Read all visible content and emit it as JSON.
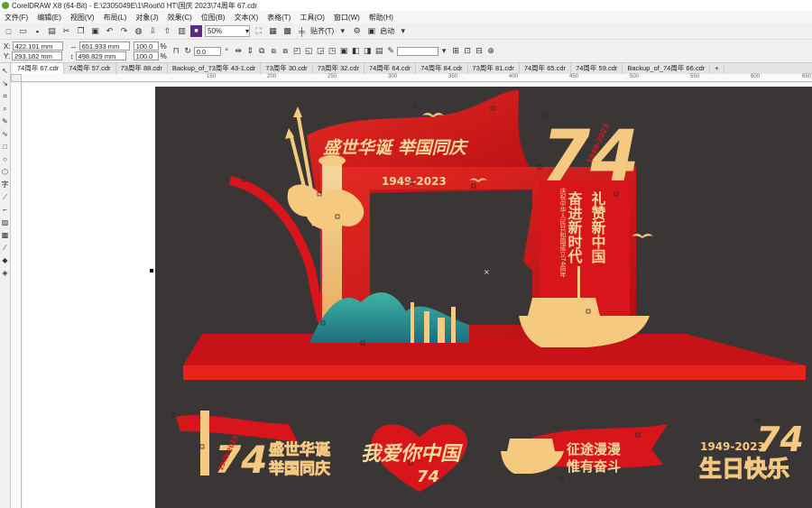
{
  "window": {
    "title": "CorelDRAW X8 (64-Bit) - E:\\2305049E\\1\\Root\\0 HT\\国庆 2023\\74周年 67.cdr"
  },
  "menu": {
    "items": [
      "文件(F)",
      "编辑(E)",
      "视图(V)",
      "布局(L)",
      "对象(J)",
      "效果(C)",
      "位图(B)",
      "文本(X)",
      "表格(T)",
      "工具(O)",
      "窗口(W)",
      "帮助(H)"
    ]
  },
  "toolbar": {
    "zoom": "50%",
    "snap_label": "贴齐(T)",
    "launch_label": "启动"
  },
  "properties": {
    "x": "422.101 mm",
    "y": "293.182 mm",
    "w": "651.933 mm",
    "h": "498.829 mm",
    "scale_w": "100.0",
    "scale_h": "100.0",
    "pct": "%",
    "angle": "0.0"
  },
  "tabs": [
    "74周年 67.cdr",
    "74周年 57.cdr",
    "73周年 88.cdr",
    "Backup_of_73周年 43-1.cdr",
    "73周年 30.cdr",
    "73周年 32.cdr",
    "74周年 64.cdr",
    "74周年 84.cdr",
    "73周年 81.cdr",
    "74周年 65.cdr",
    "74周年 59.cdr",
    "Backup_of_74周年 66.cdr",
    "+"
  ],
  "ruler": {
    "marks": [
      "150",
      "200",
      "250",
      "300",
      "350",
      "400",
      "450",
      "500",
      "550",
      "600",
      "650"
    ]
  },
  "design": {
    "banner": "盛世华诞 举国同庆",
    "years": "1949-2023",
    "big_number": "74",
    "badge_years": "1949-2023",
    "vertical_left": "奋进新时代",
    "vertical_right": "礼赞新中国",
    "vertical_small": "庆祝中华人民共和国成立74周年",
    "colors": {
      "red": "#d7151b",
      "gold": "#f5c97f",
      "dark": "#3b3636"
    }
  },
  "logos": {
    "logo1_num": "74",
    "logo1_years": "1949-2023",
    "logo1_l1": "盛世华诞",
    "logo1_l2": "举国同庆",
    "logo2_text": "我爱你中国",
    "logo2_num": "74",
    "logo3_l1": "征途漫漫",
    "logo3_l2": "惟有奋斗",
    "logo4_years": "1949-2023",
    "logo4_num": "74",
    "logo4_text": "生日快乐"
  }
}
